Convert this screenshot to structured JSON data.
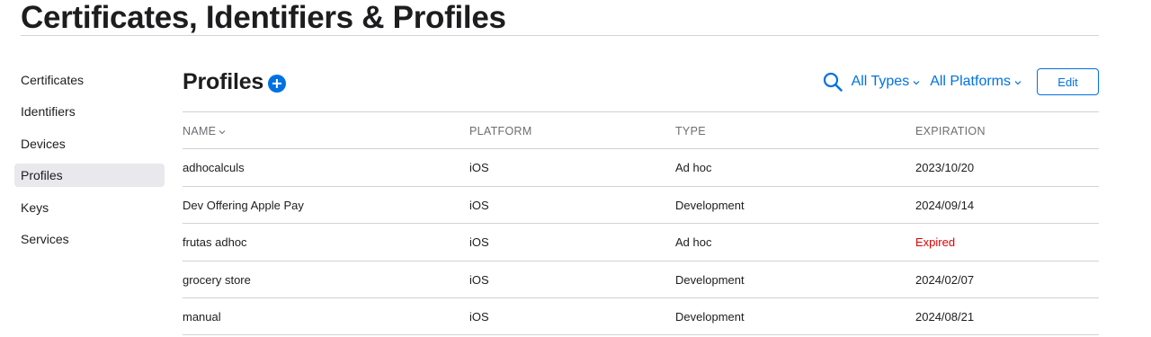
{
  "page": {
    "title": "Certificates, Identifiers & Profiles"
  },
  "sidebar": {
    "items": [
      {
        "label": "Certificates",
        "active": false
      },
      {
        "label": "Identifiers",
        "active": false
      },
      {
        "label": "Devices",
        "active": false
      },
      {
        "label": "Profiles",
        "active": true
      },
      {
        "label": "Keys",
        "active": false
      },
      {
        "label": "Services",
        "active": false
      }
    ]
  },
  "section": {
    "title": "Profiles",
    "add_icon": "plus-circle-icon"
  },
  "toolbar": {
    "search_icon": "search-icon",
    "type_filter": "All Types",
    "platform_filter": "All Platforms",
    "edit_label": "Edit"
  },
  "table": {
    "columns": [
      "NAME",
      "PLATFORM",
      "TYPE",
      "EXPIRATION"
    ],
    "sort_icon": "chevron-down-icon",
    "rows": [
      {
        "name": "adhocalculs",
        "platform": "iOS",
        "type": "Ad hoc",
        "expiration": "2023/10/20",
        "expired": false
      },
      {
        "name": "Dev Offering Apple Pay",
        "platform": "iOS",
        "type": "Development",
        "expiration": "2024/09/14",
        "expired": false
      },
      {
        "name": "frutas adhoc",
        "platform": "iOS",
        "type": "Ad hoc",
        "expiration": "Expired",
        "expired": true
      },
      {
        "name": "grocery store",
        "platform": "iOS",
        "type": "Development",
        "expiration": "2024/02/07",
        "expired": false
      },
      {
        "name": "manual",
        "platform": "iOS",
        "type": "Development",
        "expiration": "2024/08/21",
        "expired": false
      }
    ]
  },
  "colors": {
    "accent": "#0071e3",
    "expired": "#e30000",
    "active_bg": "#e8e8ed",
    "divider": "#d2d2d7"
  }
}
